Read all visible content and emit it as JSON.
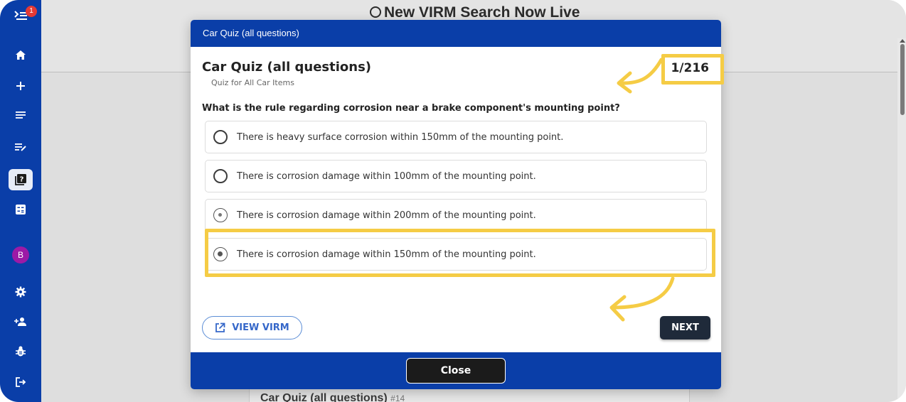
{
  "sidebar": {
    "notification_count": "1",
    "avatar_letter": "B",
    "items": [
      {
        "icon": "notifications-icon"
      },
      {
        "icon": "home-icon"
      },
      {
        "icon": "plus-icon"
      },
      {
        "icon": "list-icon"
      },
      {
        "icon": "playlist-edit-icon"
      },
      {
        "icon": "quiz-icon",
        "active": true
      },
      {
        "icon": "calculator-icon"
      },
      {
        "icon": "settings-icon"
      },
      {
        "icon": "add-user-icon"
      },
      {
        "icon": "bug-icon"
      },
      {
        "icon": "logout-icon"
      }
    ]
  },
  "background": {
    "headline": "New VIRM Search Now Live",
    "card_title": "Car Quiz (all questions)",
    "card_number": "#14"
  },
  "modal": {
    "topbar_title": "Car Quiz (all questions)",
    "quiz_title": "Car Quiz (all questions)",
    "quiz_subtitle": "Quiz for All Car Items",
    "progress": "1/216",
    "question": "What is the rule regarding corrosion near a brake component's mounting point?",
    "options": [
      {
        "label": "There is heavy surface corrosion within 150mm of the mounting point.",
        "state": "unselected"
      },
      {
        "label": "There is corrosion damage within 100mm of the mounting point.",
        "state": "unselected"
      },
      {
        "label": "There is corrosion damage within 200mm of the mounting point.",
        "state": "hover"
      },
      {
        "label": "There is corrosion damage within 150mm of the mounting point.",
        "state": "selected"
      }
    ],
    "view_virm_label": "VIEW VIRM",
    "next_label": "NEXT",
    "close_label": "Close"
  },
  "colors": {
    "brand_blue": "#0a3ea8",
    "highlight_yellow": "#f5cc45",
    "next_button": "#1f2a3a"
  }
}
